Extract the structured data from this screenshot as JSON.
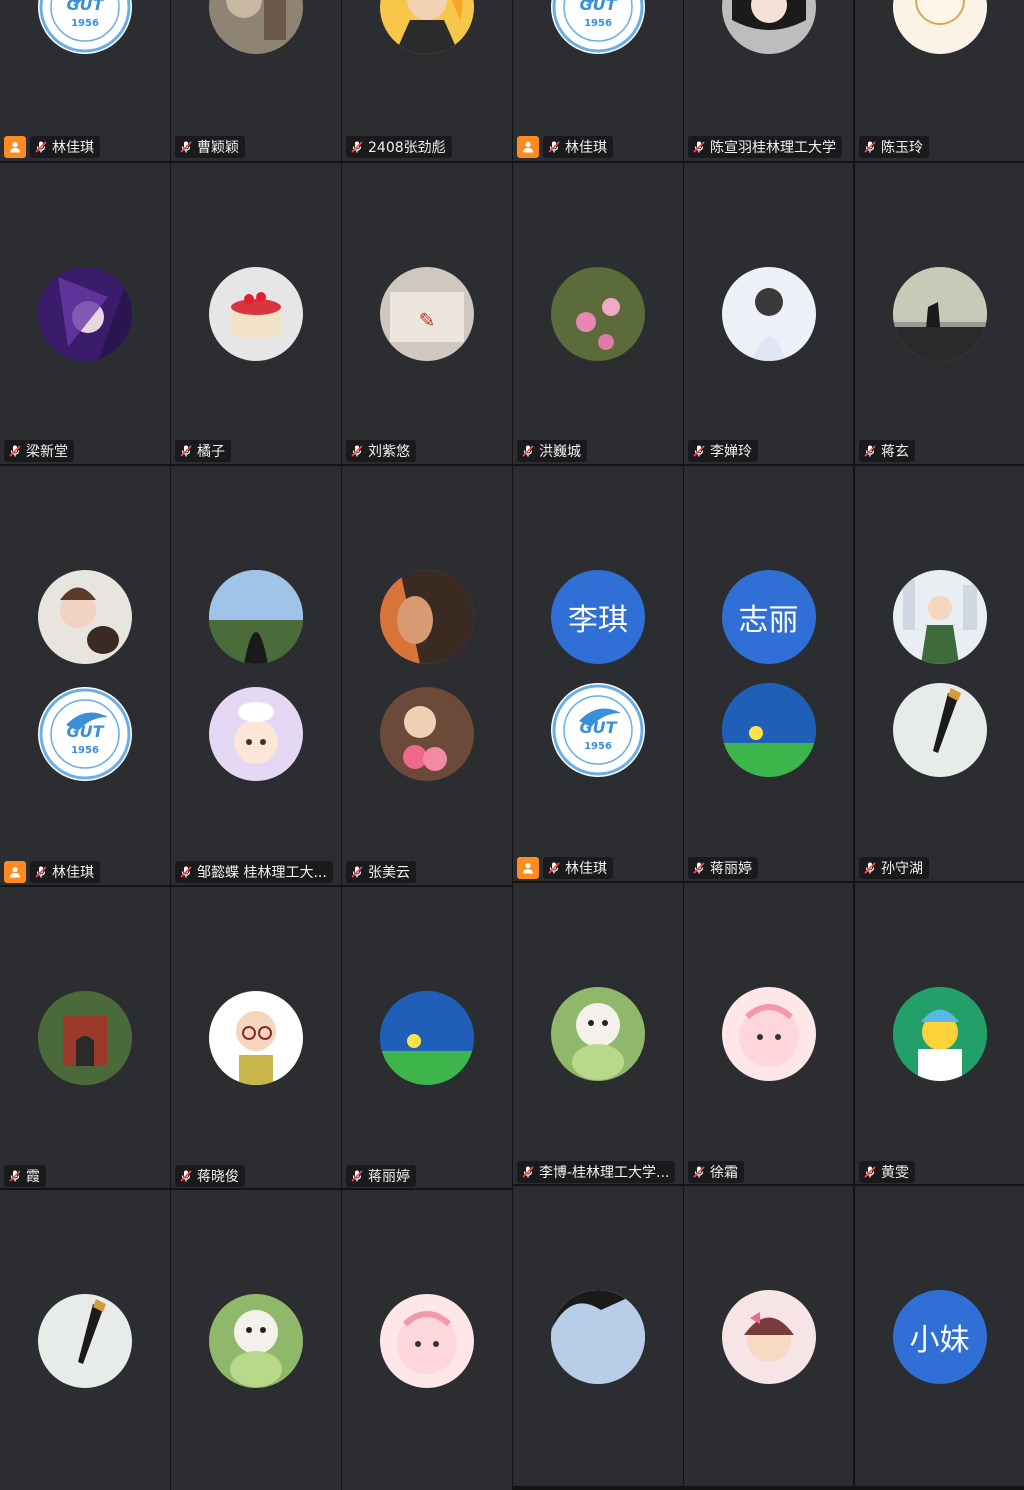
{
  "colors": {
    "tile_bg": "#2b2d30",
    "page_bg": "#131416",
    "host_badge": "#ff8a1f",
    "initials_bg": "#2f6fd6"
  },
  "participants": [
    {
      "name": "林佳琪",
      "host": true,
      "avatars": [
        {
          "icon": "gut-university-logo-icon",
          "text": "1956"
        }
      ]
    },
    {
      "name": "曹颖颖",
      "host": false,
      "avatars": [
        {
          "icon": "portrait-photo-avatar-icon"
        }
      ]
    },
    {
      "name": "2408张劲彪",
      "host": false,
      "avatars": [
        {
          "icon": "cartoon-girl-avatar-icon"
        }
      ]
    },
    {
      "name": "林佳琪",
      "host": true,
      "avatars": [
        {
          "icon": "gut-university-logo-icon",
          "text": "1956"
        }
      ]
    },
    {
      "name": "陈宣羽桂林理工大学",
      "host": false,
      "avatars": [
        {
          "icon": "anime-girl-avatar-icon"
        }
      ]
    },
    {
      "name": "陈玉玲",
      "host": false,
      "avatars": [
        {
          "icon": "sketch-girl-avatar-icon"
        }
      ]
    },
    {
      "name": "梁新堂",
      "host": false,
      "avatars": [
        {
          "icon": "anime-warrior-avatar-icon"
        }
      ]
    },
    {
      "name": "橘子",
      "host": false,
      "avatars": [
        {
          "icon": "strawberry-cake-avatar-icon"
        }
      ]
    },
    {
      "name": "刘紫悠",
      "host": false,
      "avatars": [
        {
          "icon": "handwritten-note-avatar-icon"
        }
      ]
    },
    {
      "name": "洪巍城",
      "host": false,
      "avatars": [
        {
          "icon": "magnolia-flower-avatar-icon"
        }
      ]
    },
    {
      "name": "李婵玲",
      "host": false,
      "avatars": [
        {
          "icon": "girl-back-avatar-icon"
        }
      ]
    },
    {
      "name": "蒋玄",
      "host": false,
      "avatars": [
        {
          "icon": "silhouette-sunset-avatar-icon"
        }
      ]
    },
    {
      "name": "林佳琪",
      "host": true,
      "avatars": [
        {
          "icon": "child-photo-avatar-icon"
        },
        {
          "icon": "gut-university-logo-icon",
          "text": "1956"
        }
      ]
    },
    {
      "name": "邹懿蝶 桂林理工大...",
      "host": false,
      "avatars": [
        {
          "icon": "girl-landscape-avatar-icon"
        },
        {
          "icon": "cartoon-duck-girl-avatar-icon"
        }
      ]
    },
    {
      "name": "张美云",
      "host": false,
      "avatars": [
        {
          "icon": "girl-portrait-avatar-icon"
        },
        {
          "icon": "girl-flowers-avatar-icon"
        }
      ]
    },
    {
      "name": "林佳琪",
      "host": true,
      "avatars": [
        {
          "initials": "李琪"
        },
        {
          "icon": "gut-university-logo-icon",
          "text": "1956"
        }
      ]
    },
    {
      "name": "蒋丽婷",
      "host": false,
      "avatars": [
        {
          "initials": "志丽"
        },
        {
          "icon": "firefly-night-avatar-icon"
        }
      ]
    },
    {
      "name": "孙守湖",
      "host": false,
      "avatars": [
        {
          "icon": "cartoon-man-city-avatar-icon"
        },
        {
          "icon": "fountain-pen-avatar-icon"
        }
      ]
    },
    {
      "name": "霞",
      "host": false,
      "avatars": [
        {
          "icon": "chinese-gate-avatar-icon"
        }
      ]
    },
    {
      "name": "蒋晓俊",
      "host": false,
      "avatars": [
        {
          "icon": "cartoon-glasses-man-avatar-icon"
        }
      ]
    },
    {
      "name": "蒋丽婷",
      "host": false,
      "avatars": [
        {
          "icon": "firefly-night-avatar-icon"
        }
      ]
    },
    {
      "name": "李博-桂林理工大学...",
      "host": false,
      "avatars": [
        {
          "icon": "dog-cabbage-avatar-icon"
        }
      ]
    },
    {
      "name": "徐霜",
      "host": false,
      "avatars": [
        {
          "icon": "pink-blob-avatar-icon"
        }
      ]
    },
    {
      "name": "黄雯",
      "host": false,
      "avatars": [
        {
          "icon": "smiley-beanie-avatar-icon"
        }
      ]
    },
    {
      "name": "",
      "host": false,
      "avatars": [
        {
          "icon": "fountain-pen-avatar-icon"
        }
      ]
    },
    {
      "name": "",
      "host": false,
      "avatars": [
        {
          "icon": "dog-cabbage-avatar-icon"
        }
      ]
    },
    {
      "name": "",
      "host": false,
      "avatars": [
        {
          "icon": "pink-blob-avatar-icon"
        }
      ]
    },
    {
      "name": "",
      "host": false,
      "avatars": [
        {
          "icon": "sky-silhouette-avatar-icon"
        }
      ]
    },
    {
      "name": "",
      "host": false,
      "avatars": [
        {
          "icon": "cartoon-girl-bow-avatar-icon"
        }
      ]
    },
    {
      "name": "",
      "host": false,
      "avatars": [
        {
          "initials": "小妹"
        }
      ]
    }
  ]
}
